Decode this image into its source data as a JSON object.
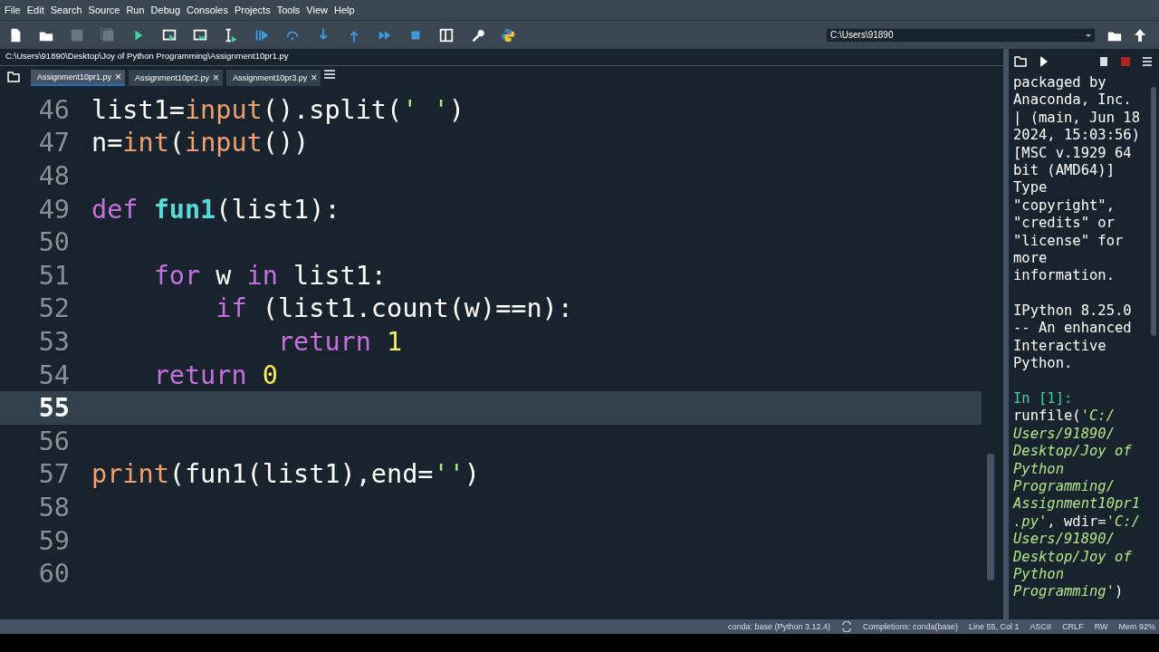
{
  "menu": [
    "File",
    "Edit",
    "Search",
    "Source",
    "Run",
    "Debug",
    "Consoles",
    "Projects",
    "Tools",
    "View",
    "Help"
  ],
  "working_dir": {
    "value": "C:\\Users\\91890"
  },
  "file_path": "C:\\Users\\91890\\Desktop\\Joy of Python Programming\\Assignment10pr1.py",
  "tabs": [
    {
      "label": "Assignment10pr1.py",
      "close": "×",
      "selected": true
    },
    {
      "label": "Assignment10pr2.py",
      "close": "×",
      "selected": false
    },
    {
      "label": "Assignment10pr3.py",
      "close": "×",
      "selected": false
    }
  ],
  "editor": {
    "lines": [
      {
        "number": "46",
        "current": false,
        "tokens": [
          {
            "kind": "plain",
            "text": "list1="
          },
          {
            "kind": "builtin",
            "text": "input"
          },
          {
            "kind": "plain",
            "text": "().split("
          },
          {
            "kind": "string",
            "text": "' '"
          },
          {
            "kind": "plain",
            "text": ")"
          }
        ]
      },
      {
        "number": "47",
        "current": false,
        "tokens": [
          {
            "kind": "plain",
            "text": "n="
          },
          {
            "kind": "builtin",
            "text": "int"
          },
          {
            "kind": "plain",
            "text": "("
          },
          {
            "kind": "builtin",
            "text": "input"
          },
          {
            "kind": "plain",
            "text": "())"
          }
        ]
      },
      {
        "number": "48",
        "current": false
      },
      {
        "number": "49",
        "current": false,
        "tokens": [
          {
            "kind": "keyword",
            "text": "def"
          },
          {
            "kind": "defname",
            "text": " fun1"
          },
          {
            "kind": "plain",
            "text": "(list1):"
          }
        ]
      },
      {
        "number": "50",
        "current": false
      },
      {
        "number": "51",
        "current": false,
        "tokens": [
          {
            "kind": "keyword",
            "text": "    for"
          },
          {
            "kind": "plain",
            "text": " w "
          },
          {
            "kind": "keyword",
            "text": "in"
          },
          {
            "kind": "plain",
            "text": " list1:"
          }
        ]
      },
      {
        "number": "52",
        "current": false,
        "tokens": [
          {
            "kind": "keyword",
            "text": "        if"
          },
          {
            "kind": "plain",
            "text": " (list1.count(w)==n):"
          }
        ]
      },
      {
        "number": "53",
        "current": false,
        "tokens": [
          {
            "kind": "keyword",
            "text": "            return"
          },
          {
            "kind": "number",
            "text": " 1"
          }
        ]
      },
      {
        "number": "54",
        "current": false,
        "tokens": [
          {
            "kind": "keyword",
            "text": "    return"
          },
          {
            "kind": "number",
            "text": " 0"
          }
        ]
      },
      {
        "number": "55",
        "current": true
      },
      {
        "number": "56",
        "current": false
      },
      {
        "number": "57",
        "current": false,
        "tokens": [
          {
            "kind": "builtin",
            "text": "print"
          },
          {
            "kind": "plain",
            "text": "(fun1(list1),end="
          },
          {
            "kind": "string",
            "text": "''"
          },
          {
            "kind": "plain",
            "text": ")"
          }
        ]
      },
      {
        "number": "58",
        "current": false
      },
      {
        "number": "59",
        "current": false
      },
      {
        "number": "60",
        "current": false
      }
    ]
  },
  "console": {
    "lines": [
      {
        "kind": "text",
        "tokens": [
          {
            "kind": "plain",
            "text": "packaged by"
          }
        ]
      },
      {
        "kind": "text",
        "tokens": [
          {
            "kind": "plain",
            "text": "Anaconda, Inc."
          }
        ]
      },
      {
        "kind": "text",
        "tokens": [
          {
            "kind": "plain",
            "text": "| (main, Jun 18"
          }
        ]
      },
      {
        "kind": "text",
        "tokens": [
          {
            "kind": "plain",
            "text": "2024, 15:03:56)"
          }
        ]
      },
      {
        "kind": "text",
        "tokens": [
          {
            "kind": "plain",
            "text": "[MSC v.1929 64"
          }
        ]
      },
      {
        "kind": "text",
        "tokens": [
          {
            "kind": "plain",
            "text": "bit (AMD64)]"
          }
        ]
      },
      {
        "kind": "text",
        "tokens": [
          {
            "kind": "plain",
            "text": "Type"
          }
        ]
      },
      {
        "kind": "text",
        "tokens": [
          {
            "kind": "plain",
            "text": "\"copyright\","
          }
        ]
      },
      {
        "kind": "text",
        "tokens": [
          {
            "kind": "plain",
            "text": "\"credits\" or"
          }
        ]
      },
      {
        "kind": "text",
        "tokens": [
          {
            "kind": "plain",
            "text": "\"license\" for"
          }
        ]
      },
      {
        "kind": "text",
        "tokens": [
          {
            "kind": "plain",
            "text": "more"
          }
        ]
      },
      {
        "kind": "text",
        "tokens": [
          {
            "kind": "plain",
            "text": "information."
          }
        ]
      },
      {
        "kind": "blank"
      },
      {
        "kind": "text",
        "tokens": [
          {
            "kind": "plain",
            "text": "IPython 8.25.0"
          }
        ]
      },
      {
        "kind": "text",
        "tokens": [
          {
            "kind": "plain",
            "text": "-- An enhanced"
          }
        ]
      },
      {
        "kind": "text",
        "tokens": [
          {
            "kind": "plain",
            "text": "Interactive"
          }
        ]
      },
      {
        "kind": "text",
        "tokens": [
          {
            "kind": "plain",
            "text": "Python."
          }
        ]
      },
      {
        "kind": "blank"
      },
      {
        "kind": "text",
        "tokens": [
          {
            "kind": "prompt",
            "text": "In [1]:"
          }
        ]
      },
      {
        "kind": "text",
        "tokens": [
          {
            "kind": "plain",
            "text": "runfile("
          },
          {
            "kind": "string",
            "text": "'C:/"
          }
        ]
      },
      {
        "kind": "text",
        "tokens": [
          {
            "kind": "string",
            "text": "Users/91890/"
          }
        ]
      },
      {
        "kind": "text",
        "tokens": [
          {
            "kind": "string",
            "text": "Desktop/Joy of"
          }
        ]
      },
      {
        "kind": "text",
        "tokens": [
          {
            "kind": "string",
            "text": "Python"
          }
        ]
      },
      {
        "kind": "text",
        "tokens": [
          {
            "kind": "string",
            "text": "Programming/"
          }
        ]
      },
      {
        "kind": "text",
        "tokens": [
          {
            "kind": "string",
            "text": "Assignment10pr1"
          }
        ]
      },
      {
        "kind": "text",
        "tokens": [
          {
            "kind": "string",
            "text": ".py'"
          },
          {
            "kind": "plain",
            "text": ", wdir="
          },
          {
            "kind": "string",
            "text": "'C:/"
          }
        ]
      },
      {
        "kind": "text",
        "tokens": [
          {
            "kind": "string",
            "text": "Users/91890/"
          }
        ]
      },
      {
        "kind": "text",
        "tokens": [
          {
            "kind": "string",
            "text": "Desktop/Joy of"
          }
        ]
      },
      {
        "kind": "text",
        "tokens": [
          {
            "kind": "string",
            "text": "Python"
          }
        ]
      },
      {
        "kind": "text",
        "tokens": [
          {
            "kind": "string",
            "text": "Programming'"
          },
          {
            "kind": "plain",
            "text": ")"
          }
        ]
      }
    ]
  },
  "status_bar": [
    "conda: base (Python 3.12.4)",
    "Completions: conda(base)",
    "Line 55, Col 1",
    "ASCII",
    "CRLF",
    "RW",
    "Mem 92%"
  ]
}
